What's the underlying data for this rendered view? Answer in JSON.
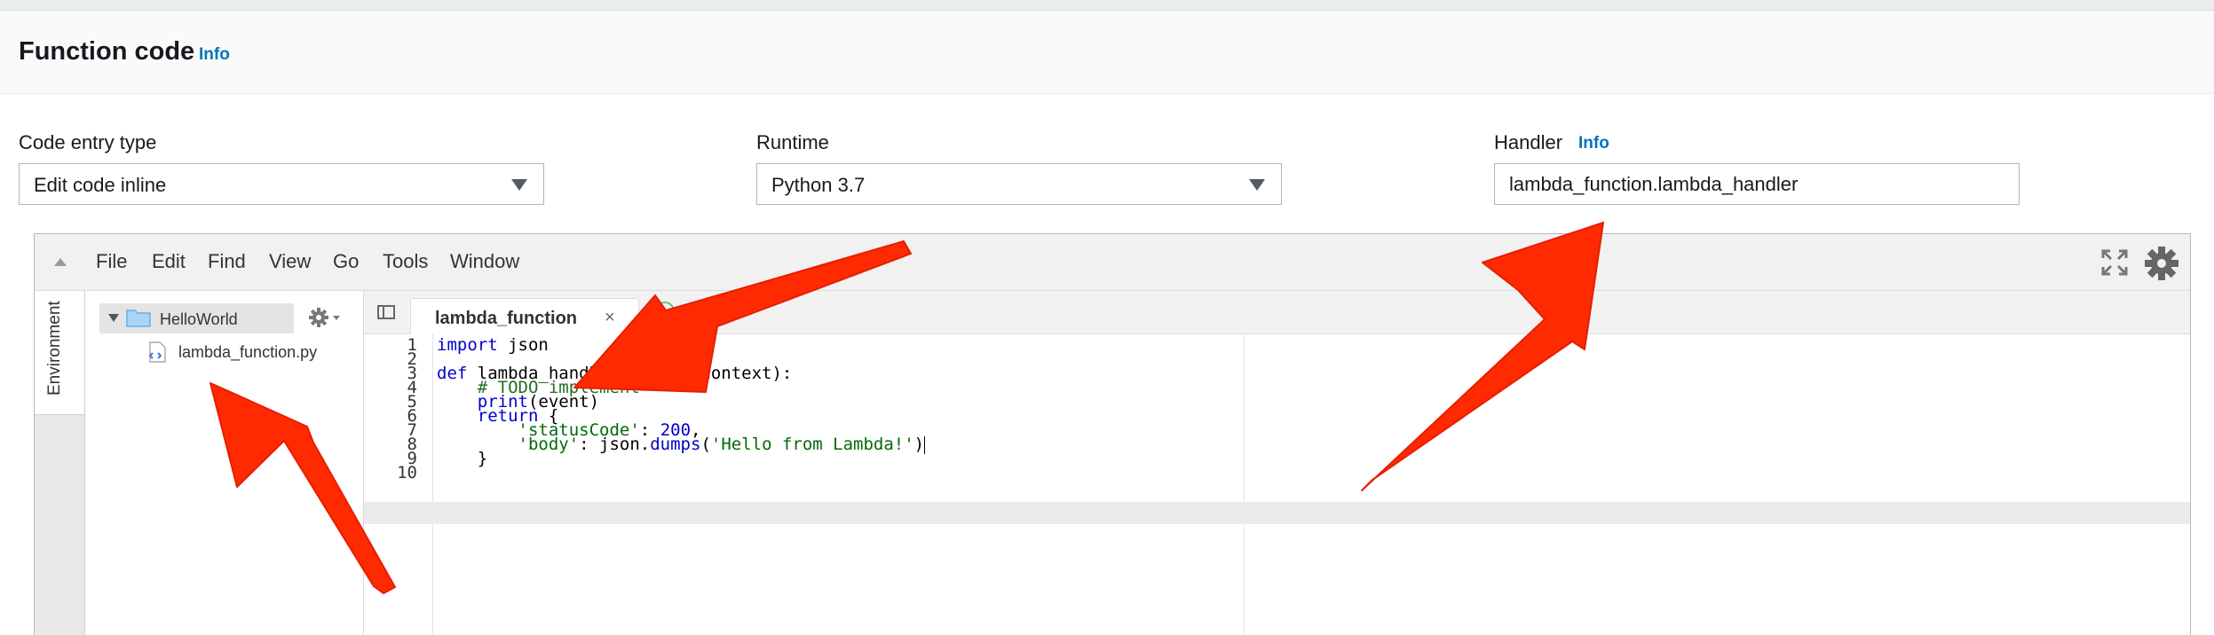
{
  "header": {
    "title": "Function code",
    "info_label": "Info"
  },
  "fields": {
    "code_entry_type": {
      "label": "Code entry type",
      "value": "Edit code inline"
    },
    "runtime": {
      "label": "Runtime",
      "value": "Python 3.7"
    },
    "handler": {
      "label": "Handler",
      "info_label": "Info",
      "value": "lambda_function.lambda_handler"
    }
  },
  "ide": {
    "menu": [
      "File",
      "Edit",
      "Find",
      "View",
      "Go",
      "Tools",
      "Window"
    ],
    "sidebar_tab": "Environment",
    "tree": {
      "root": "HelloWorld",
      "file": "lambda_function.py"
    },
    "tab": {
      "label": "lambda_function",
      "close": "×"
    },
    "line_numbers": [
      "1",
      "2",
      "3",
      "4",
      "5",
      "6",
      "7",
      "8",
      "9",
      "10"
    ],
    "code": {
      "l1_kw": "import",
      "l1_rest": " json",
      "l3_kw": "def",
      "l3_rest": " lambda_handler(event, context):",
      "l4": "    # TODO implement",
      "l5_fn": "print",
      "l5_rest": "(event)",
      "l6_kw": "return",
      "l6_rest": " {",
      "l7_str": "'statusCode'",
      "l7_mid": ": ",
      "l7_num": "200",
      "l7_end": ",",
      "l8_str1": "'body'",
      "l8_mid": ": json.",
      "l8_fn": "dumps",
      "l8_open": "(",
      "l8_str2": "'Hello from Lambda!'",
      "l8_close": ")",
      "l9": "    }"
    }
  },
  "colors": {
    "accent": "#0073bb",
    "annotation_arrow": "#ff2a00"
  }
}
